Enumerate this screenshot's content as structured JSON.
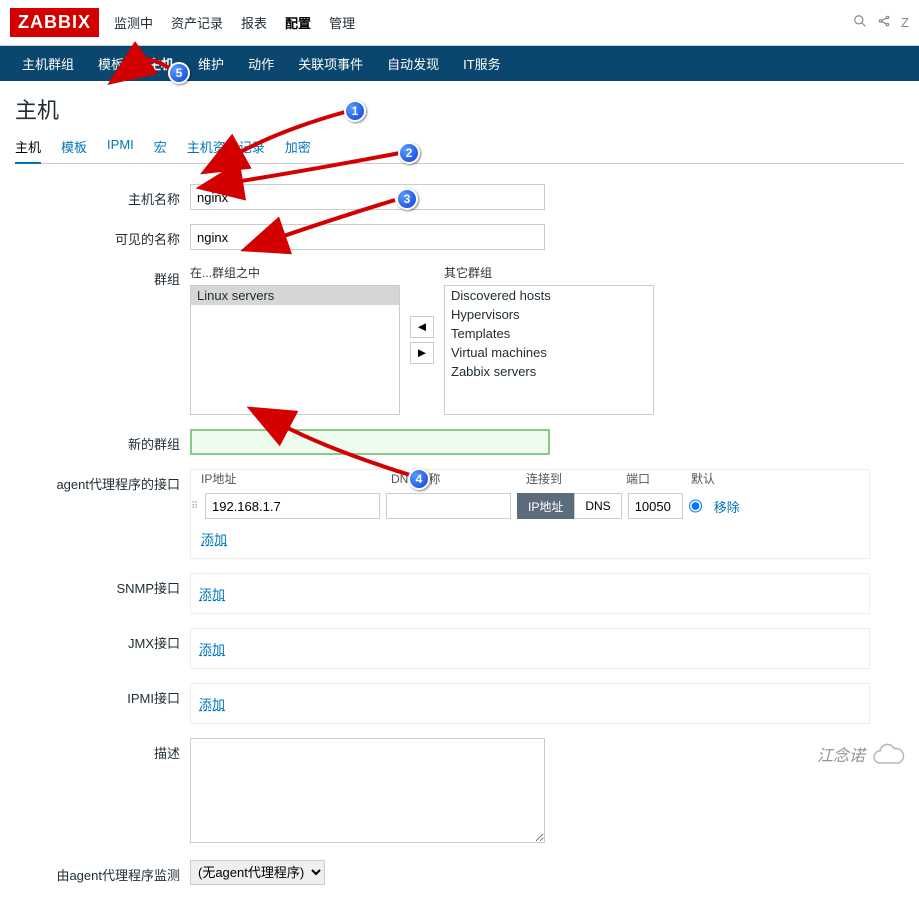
{
  "logo": "ZABBIX",
  "top_menu": {
    "items": [
      "监测中",
      "资产记录",
      "报表",
      "配置",
      "管理"
    ],
    "active_index": 3
  },
  "top_right": {
    "icons": [
      "search",
      "share"
    ],
    "letter": "Z"
  },
  "sub_nav": {
    "items": [
      "主机群组",
      "模板",
      "主机",
      "维护",
      "动作",
      "关联项事件",
      "自动发现",
      "IT服务"
    ],
    "active_index": 2
  },
  "page_title": "主机",
  "tabs": {
    "items": [
      "主机",
      "模板",
      "IPMI",
      "宏",
      "主机资产记录",
      "加密"
    ],
    "active_index": 0
  },
  "form": {
    "host_name_label": "主机名称",
    "host_name_value": "nginx",
    "visible_name_label": "可见的名称",
    "visible_name_value": "nginx",
    "groups_label": "群组",
    "groups_in_label": "在...群组之中",
    "groups_other_label": "其它群组",
    "in_groups": [
      "Linux servers"
    ],
    "other_groups": [
      "Discovered hosts",
      "Hypervisors",
      "Templates",
      "Virtual machines",
      "Zabbix servers"
    ],
    "move_left": "◄",
    "move_right": "►",
    "new_group_label": "新的群组",
    "new_group_value": "",
    "agent_iface_label": "agent代理程序的接口",
    "iface_headers": {
      "ip": "IP地址",
      "dns": "DNS名称",
      "connect": "连接到",
      "port": "端口",
      "default": "默认"
    },
    "agent_ip": "192.168.1.7",
    "agent_dns": "",
    "toggle_ip": "IP地址",
    "toggle_dns": "DNS",
    "agent_port": "10050",
    "remove_label": "移除",
    "add_label": "添加",
    "snmp_label": "SNMP接口",
    "jmx_label": "JMX接口",
    "ipmi_label": "IPMI接口",
    "desc_label": "描述",
    "desc_value": "",
    "proxy_label": "由agent代理程序监测",
    "proxy_value": "(无agent代理程序)"
  },
  "callouts": {
    "c1": "1",
    "c2": "2",
    "c3": "3",
    "c4": "4",
    "c5": "5"
  },
  "watermark": "江念诺"
}
